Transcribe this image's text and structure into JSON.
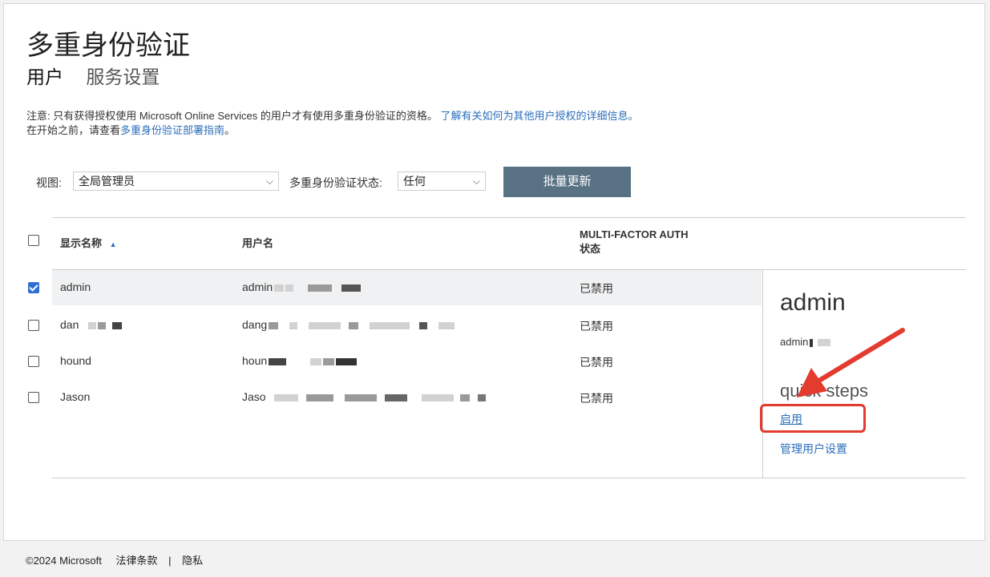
{
  "header": {
    "title": "多重身份验证",
    "tabs": [
      {
        "label": "用户",
        "active": true
      },
      {
        "label": "服务设置",
        "active": false
      }
    ]
  },
  "notice": {
    "line1_text": "注意: 只有获得授权使用 Microsoft Online Services 的用户才有使用多重身份验证的资格。",
    "line1_link": "了解有关如何为其他用户授权的详细信息。",
    "line2_text": "在开始之前，请查看",
    "line2_link": "多重身份验证部署指南",
    "line2_end": "。"
  },
  "toolbar": {
    "view_label": "视图:",
    "view_value": "全局管理员",
    "mfa_status_label": "多重身份验证状态:",
    "mfa_status_value": "任何",
    "bulk_update_label": "批量更新",
    "chevron": "⌵"
  },
  "table": {
    "columns": {
      "display_name": "显示名称",
      "sort_indicator": "▲",
      "username": "用户名",
      "mfa_line1": "MULTI-FACTOR AUTH",
      "mfa_line2": "状态"
    },
    "rows": [
      {
        "display_name": "admin",
        "username": "admin",
        "status": "已禁用",
        "checked": true,
        "selected": true
      },
      {
        "display_name": "dan",
        "username": "dang",
        "status": "已禁用",
        "checked": false,
        "selected": false
      },
      {
        "display_name": "hound",
        "username": "houn",
        "status": "已禁用",
        "checked": false,
        "selected": false
      },
      {
        "display_name": "Jason",
        "username": "Jaso",
        "status": "已禁用",
        "checked": false,
        "selected": false
      }
    ]
  },
  "side_panel": {
    "name": "admin",
    "username": "admin",
    "quick_steps_label": "quick steps",
    "enable_link": "启用",
    "manage_settings_link": "管理用户设置"
  },
  "annotation": {
    "color": "#e33b2e"
  },
  "footer": {
    "copyright": "©2024 Microsoft",
    "legal": "法律条款",
    "separator": "|",
    "privacy": "隐私"
  }
}
